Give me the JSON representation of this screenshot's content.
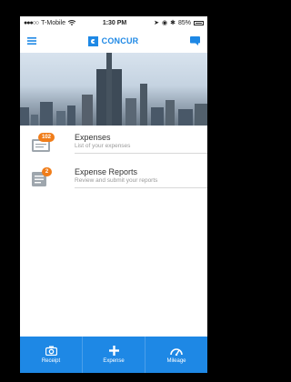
{
  "status_bar": {
    "carrier": "T-Mobile",
    "time": "1:30 PM",
    "battery": "85%"
  },
  "header": {
    "brand": "CONCUR"
  },
  "list": {
    "items": [
      {
        "title": "Expenses",
        "subtitle": "List of your expenses",
        "badge": "102",
        "icon": "receipt-stack-icon"
      },
      {
        "title": "Expense Reports",
        "subtitle": "Review and submit your reports",
        "badge": "2",
        "icon": "report-folder-icon"
      }
    ]
  },
  "tabbar": {
    "tabs": [
      {
        "label": "Receipt",
        "icon": "camera-icon"
      },
      {
        "label": "Expense",
        "icon": "plus-icon"
      },
      {
        "label": "Mileage",
        "icon": "speedometer-icon"
      }
    ]
  },
  "colors": {
    "accent": "#1e88e5",
    "badge": "#f07d1a",
    "background": "#000000"
  }
}
